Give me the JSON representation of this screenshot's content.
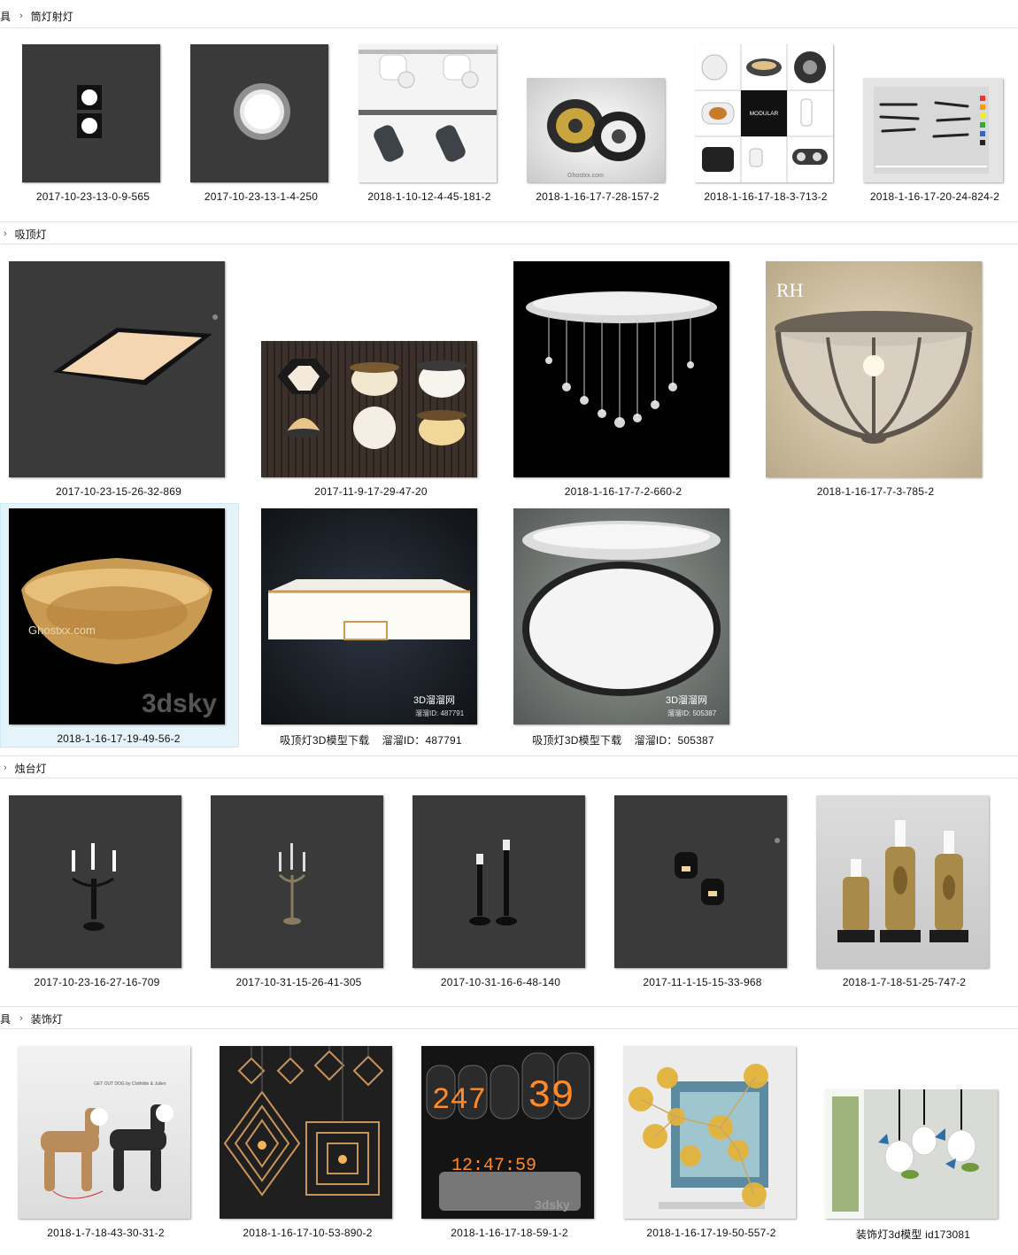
{
  "sections": [
    {
      "prefix": "具",
      "title": "筒灯射灯"
    },
    {
      "prefix": "",
      "title": "吸顶灯"
    },
    {
      "prefix": "",
      "title": "烛台灯"
    },
    {
      "prefix": "具",
      "title": "装饰灯"
    }
  ],
  "chevron": "›",
  "files": {
    "row1": [
      "2017-10-23-13-0-9-565",
      "2017-10-23-13-1-4-250",
      "2018-1-10-12-4-45-181-2",
      "2018-1-16-17-7-28-157-2",
      "2018-1-16-17-18-3-713-2",
      "2018-1-16-17-20-24-824-2"
    ],
    "row2": [
      "2017-10-23-15-26-32-869",
      "2017-11-9-17-29-47-20",
      "2018-1-16-17-7-2-660-2",
      "2018-1-16-17-7-3-785-2"
    ],
    "row3": [
      "2018-1-16-17-19-49-56-2",
      "吸顶灯3D模型下载    溜溜ID：487791",
      "吸顶灯3D模型下载    溜溜ID：505387"
    ],
    "row4": [
      "2017-10-23-16-27-16-709",
      "2017-10-31-15-26-41-305",
      "2017-10-31-16-6-48-140",
      "2017-11-1-15-15-33-968",
      "2018-1-7-18-51-25-747-2"
    ],
    "row5": [
      "2018-1-7-18-43-30-31-2",
      "2018-1-16-17-10-53-890-2",
      "2018-1-16-17-18-59-1-2",
      "2018-1-16-17-19-50-557-2",
      "装饰灯3d模型 id173081"
    ]
  },
  "thumb_text": {
    "rh_logo": "RH",
    "modular_logo": "MODULAR",
    "ghostxx": "Ghostxx.com",
    "sky": "3dsky",
    "liuliu_brand": "3D溜溜网",
    "liuliu_id1": "溜溜ID: 487791",
    "liuliu_id2": "溜溜ID: 505387",
    "nixie_top": "247",
    "nixie_top2": "39",
    "nixie_bottom": "12:47:59",
    "dog_caption": "GET OUT DOG by Clothilde & Julien"
  },
  "colors": {
    "dark_bg": "#3a3a3a",
    "selection": "#e5f3fb",
    "divider": "#e5e5e5",
    "brass": "#b8923e",
    "amber": "#e8b24a"
  }
}
